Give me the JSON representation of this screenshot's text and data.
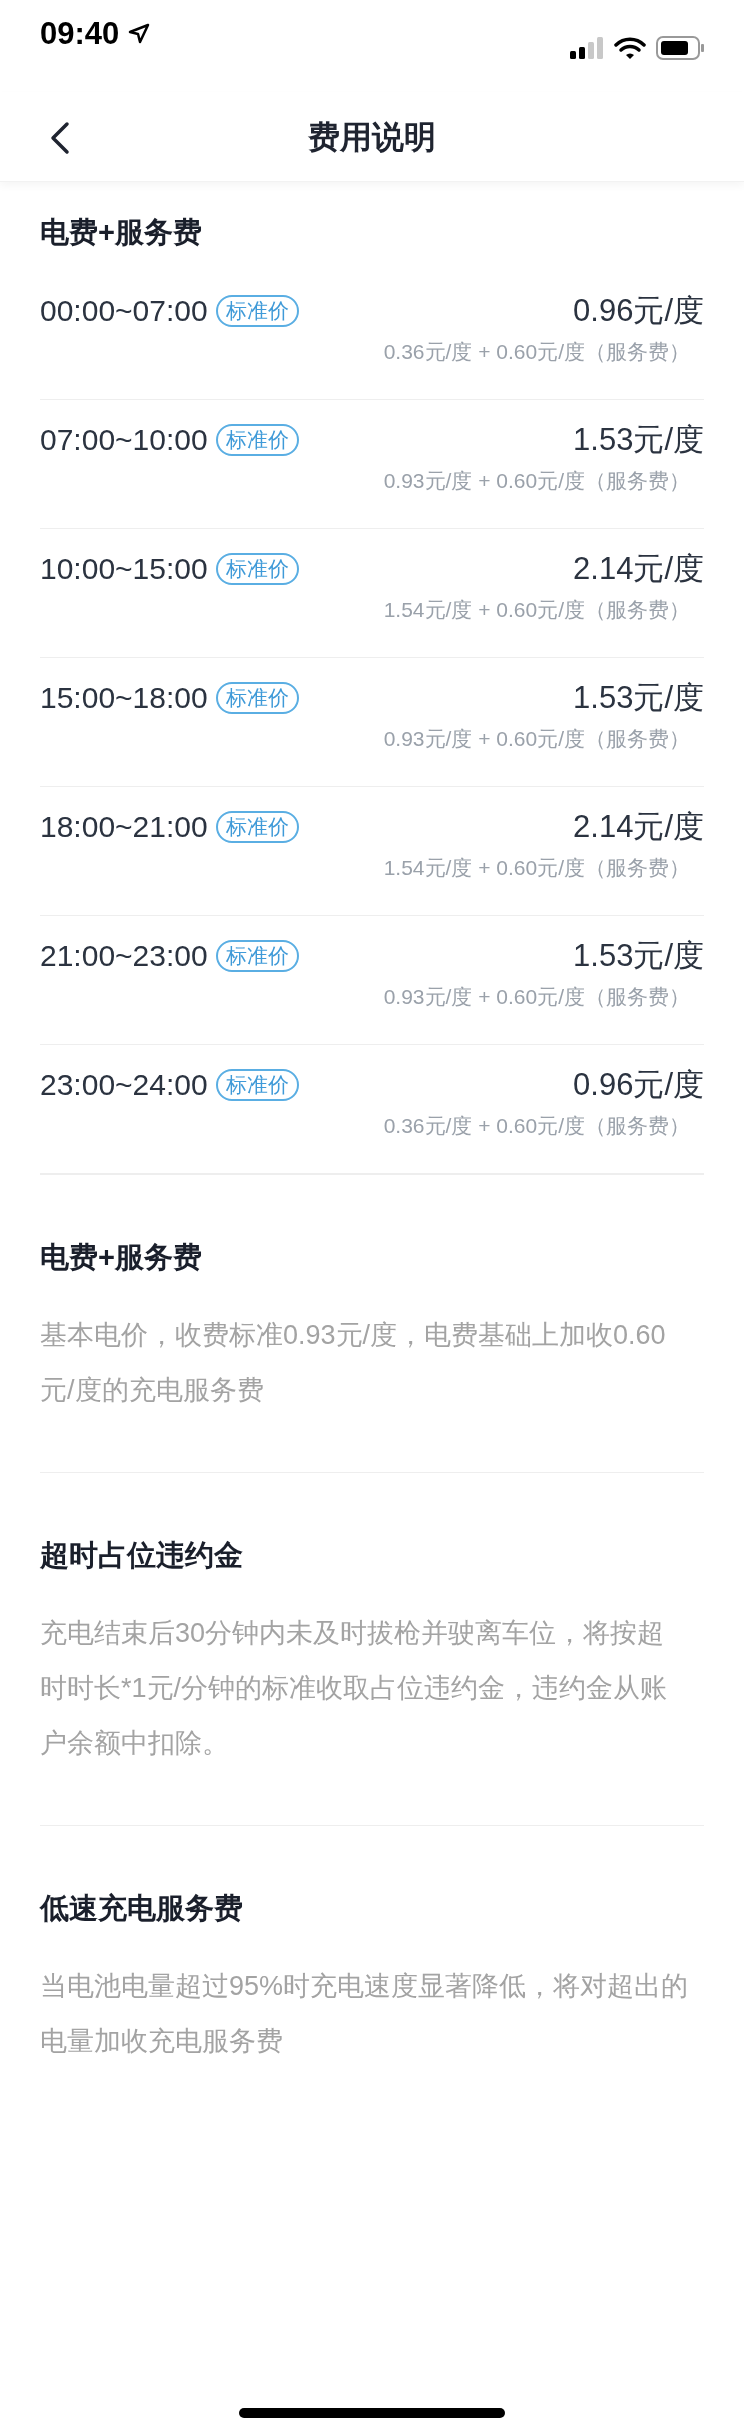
{
  "status_bar": {
    "time": "09:40"
  },
  "header": {
    "title": "费用说明"
  },
  "sections": [
    {
      "kind": "rates",
      "title": "电费+服务费",
      "rows": [
        {
          "time": "00:00~07:00",
          "badge": "标准价",
          "price": "0.96元/度",
          "breakdown": "0.36元/度 + 0.60元/度（服务费）"
        },
        {
          "time": "07:00~10:00",
          "badge": "标准价",
          "price": "1.53元/度",
          "breakdown": "0.93元/度 + 0.60元/度（服务费）"
        },
        {
          "time": "10:00~15:00",
          "badge": "标准价",
          "price": "2.14元/度",
          "breakdown": "1.54元/度 + 0.60元/度（服务费）"
        },
        {
          "time": "15:00~18:00",
          "badge": "标准价",
          "price": "1.53元/度",
          "breakdown": "0.93元/度 + 0.60元/度（服务费）"
        },
        {
          "time": "18:00~21:00",
          "badge": "标准价",
          "price": "2.14元/度",
          "breakdown": "1.54元/度 + 0.60元/度（服务费）"
        },
        {
          "time": "21:00~23:00",
          "badge": "标准价",
          "price": "1.53元/度",
          "breakdown": "0.93元/度 + 0.60元/度（服务费）"
        },
        {
          "time": "23:00~24:00",
          "badge": "标准价",
          "price": "0.96元/度",
          "breakdown": "0.36元/度 + 0.60元/度（服务费）"
        }
      ]
    },
    {
      "kind": "text",
      "title": "电费+服务费",
      "body": "基本电价，收费标准0.93元/度，电费基础上加收0.60元/度的充电服务费"
    },
    {
      "kind": "text",
      "title": "超时占位违约金",
      "body": "充电结束后30分钟内未及时拔枪并驶离车位，将按超时时长*1元/分钟的标准收取占位违约金，违约金从账户余额中扣除。"
    },
    {
      "kind": "text",
      "title": "低速充电服务费",
      "body": "当电池电量超过95%时充电速度显著降低，将对超出的电量加收充电服务费"
    }
  ]
}
